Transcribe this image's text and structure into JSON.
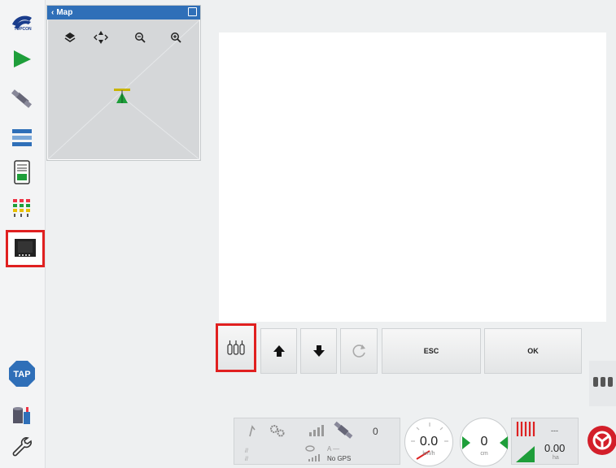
{
  "sidebar": {
    "brand_text": "TOPCON",
    "tap_label": "TAP",
    "items": [
      {
        "icon": "topcon-logo-icon"
      },
      {
        "icon": "guidance-arrow-icon"
      },
      {
        "icon": "gps-satellite-icon"
      },
      {
        "icon": "implement-setup-icon"
      },
      {
        "icon": "console-icon"
      },
      {
        "icon": "sections-icon"
      },
      {
        "icon": "display-screen-icon"
      },
      {
        "icon": "tap-icon"
      },
      {
        "icon": "job-data-icon"
      },
      {
        "icon": "wrench-icon"
      }
    ]
  },
  "map": {
    "title": "Map",
    "back_glyph": "‹"
  },
  "buttons": {
    "esc": "ESC",
    "ok": "OK"
  },
  "status": {
    "satellite_count": "0",
    "gps_status": "No GPS",
    "speed_value": "0.0",
    "speed_unit": "km/h",
    "offset_value": "0",
    "offset_unit": "cm",
    "area_top": "---",
    "area_value": "0.00",
    "area_unit": "ha"
  },
  "colors": {
    "accent_blue": "#2f6fb8",
    "highlight_red": "#e02020",
    "guidance_green": "#1e9e3a"
  }
}
